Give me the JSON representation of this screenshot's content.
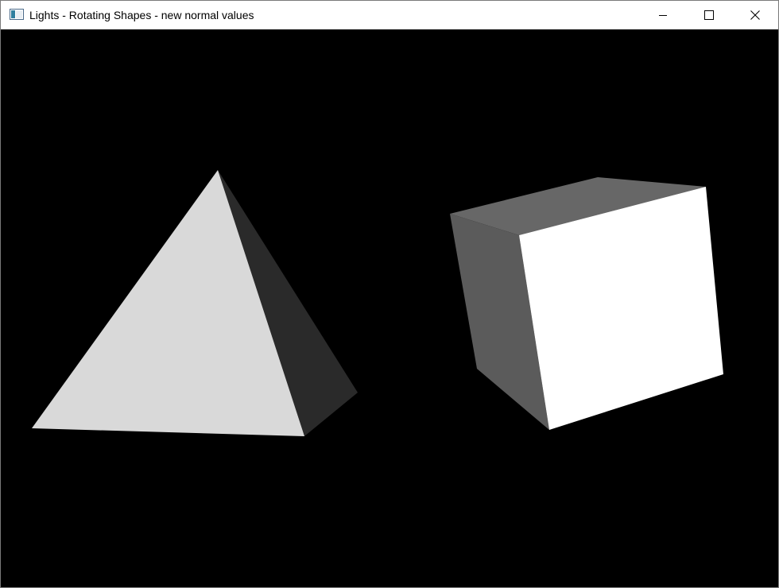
{
  "window": {
    "title": "Lights - Rotating Shapes - new normal values",
    "icon": "app-window-icon",
    "controls": {
      "minimize_icon": "minimize-icon",
      "maximize_icon": "maximize-icon",
      "close_icon": "close-icon"
    }
  },
  "scene": {
    "background": "#000000",
    "shapes": [
      {
        "name": "pyramid",
        "faces": [
          {
            "name": "front-face",
            "color": "#d9d9d9"
          },
          {
            "name": "side-face",
            "color": "#2a2a2a"
          }
        ]
      },
      {
        "name": "cube",
        "faces": [
          {
            "name": "top-face",
            "color": "#676767"
          },
          {
            "name": "left-face",
            "color": "#5b5b5b"
          },
          {
            "name": "front-face",
            "color": "#ffffff"
          }
        ]
      }
    ]
  }
}
